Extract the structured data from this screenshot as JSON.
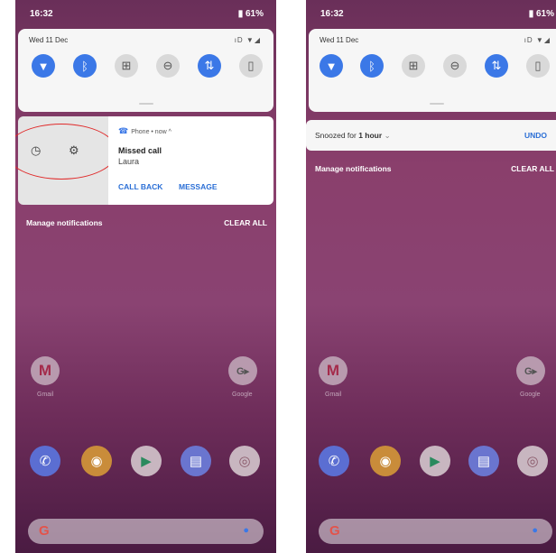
{
  "left_screen": {
    "status": {
      "time": "16:32",
      "battery": "▮ 61%"
    },
    "quick_settings": {
      "date": "Wed 11 Dec",
      "system_icons": "ıD ▼◢"
    },
    "notification": {
      "app_line": "Phone • now ^",
      "title": "Missed call",
      "subtitle": "Laura",
      "actions": [
        "CALL BACK",
        "MESSAGE"
      ]
    },
    "manage_label": "Manage notifications",
    "clear_label": "CLEAR ALL",
    "home": {
      "gmail_label": "Gmail",
      "google_label": "Google"
    }
  },
  "right_screen": {
    "status": {
      "time": "16:32",
      "battery": "▮ 61%"
    },
    "quick_settings": {
      "date": "Wed 11 Dec",
      "system_icons": "ıD ▼◢"
    },
    "snoozed": {
      "text_prefix": "Snoozed for ",
      "duration": "1 hour",
      "undo": "UNDO"
    },
    "manage_label": "Manage notifications",
    "clear_label": "CLEAR ALL",
    "home": {
      "gmail_label": "Gmail",
      "google_label": "Google"
    }
  },
  "colors": {
    "accent": "#3b78e7",
    "annotation": "#e02a2a",
    "wallpaper_top": "#6a2f59",
    "wallpaper_bottom": "#4a1b42"
  },
  "icons": [
    "wifi-icon",
    "bluetooth-icon",
    "battery-saver-icon",
    "dnd-icon",
    "data-icon",
    "flashlight-icon",
    "snooze-icon",
    "gear-icon",
    "phone-missed-icon",
    "chevron-down-icon",
    "mic-icon"
  ]
}
